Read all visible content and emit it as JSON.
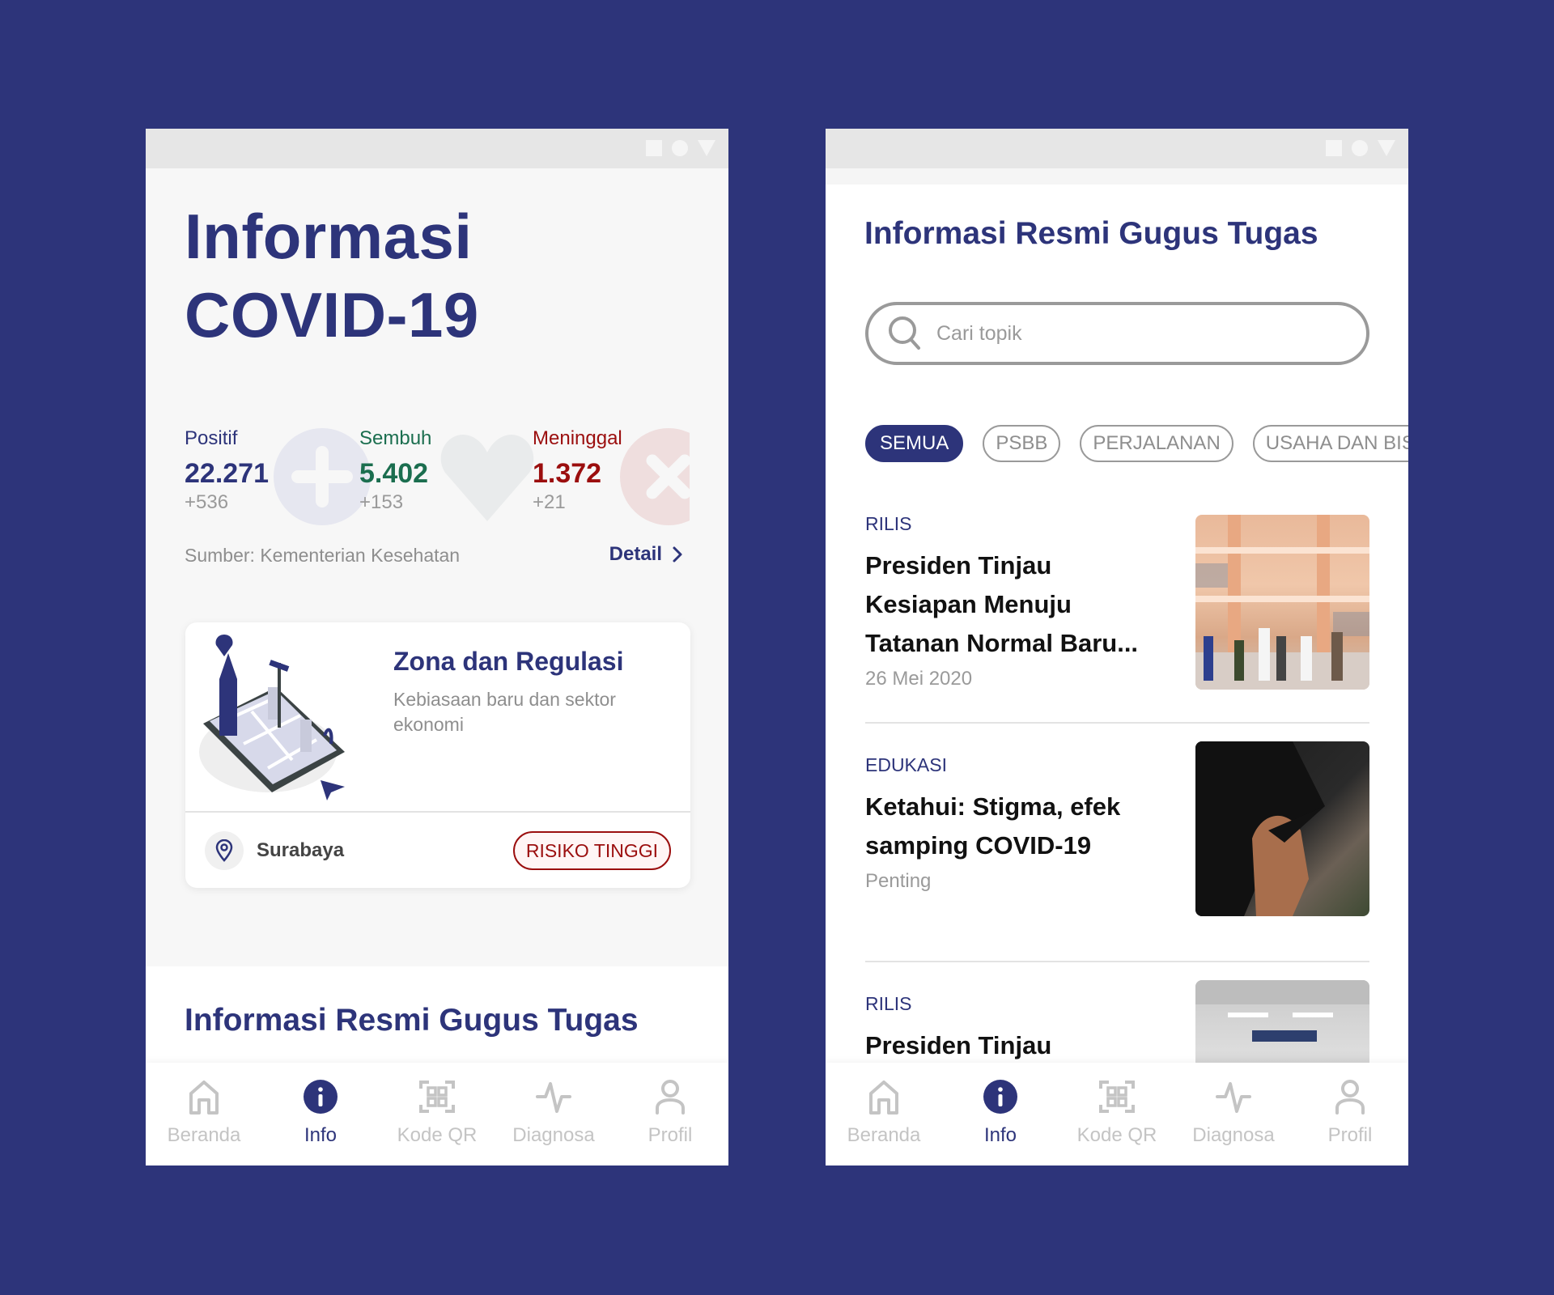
{
  "colors": {
    "background": "#2d347a",
    "primary": "#2d347a",
    "positive": "#2d347a",
    "recovered": "#1b6e4f",
    "death": "#9b0e0e",
    "muted": "#9a9a9a"
  },
  "phone1": {
    "title_line1": "Informasi",
    "title_line2": "COVID-19",
    "stats": [
      {
        "label": "Positif",
        "value": "22.271",
        "delta": "+536",
        "icon": "plus-icon"
      },
      {
        "label": "Sembuh",
        "value": "5.402",
        "delta": "+153",
        "icon": "heart-icon"
      },
      {
        "label": "Meninggal",
        "value": "1.372",
        "delta": "+21",
        "icon": "cross-icon"
      }
    ],
    "source": "Sumber: Kementerian Kesehatan",
    "detail_label": "Detail",
    "zone_card": {
      "title": "Zona dan Regulasi",
      "subtitle": "Kebiasaan baru dan sektor ekonomi",
      "location": "Surabaya",
      "risk_badge": "RISIKO TINGGI"
    },
    "section_title": "Informasi Resmi Gugus Tugas"
  },
  "phone2": {
    "title": "Informasi Resmi Gugus Tugas",
    "search": {
      "placeholder": "Cari topik",
      "value": ""
    },
    "chips": [
      {
        "label": "SEMUA",
        "active": true
      },
      {
        "label": "PSBB",
        "active": false
      },
      {
        "label": "PERJALANAN",
        "active": false
      },
      {
        "label": "USAHA DAN BISNIS",
        "active": false
      }
    ],
    "news": [
      {
        "category": "RILIS",
        "title": "Presiden Tinjau Kesiapan Menuju Tatanan Normal Baru...",
        "meta": "26 Mei 2020",
        "image": "mall-press-conference-photo"
      },
      {
        "category": "EDUKASI",
        "title": "Ketahui: Stigma, efek samping COVID-19",
        "meta": "Penting",
        "image": "person-covering-face-photo"
      },
      {
        "category": "RILIS",
        "title": "Presiden Tinjau",
        "meta": "",
        "image": "station-entrance-photo"
      }
    ]
  },
  "nav": {
    "items": [
      {
        "label": "Beranda",
        "icon": "home-icon",
        "active": false
      },
      {
        "label": "Info",
        "icon": "info-icon",
        "active": true
      },
      {
        "label": "Kode QR",
        "icon": "qr-code-icon",
        "active": false
      },
      {
        "label": "Diagnosa",
        "icon": "pulse-icon",
        "active": false
      },
      {
        "label": "Profil",
        "icon": "user-icon",
        "active": false
      }
    ]
  }
}
